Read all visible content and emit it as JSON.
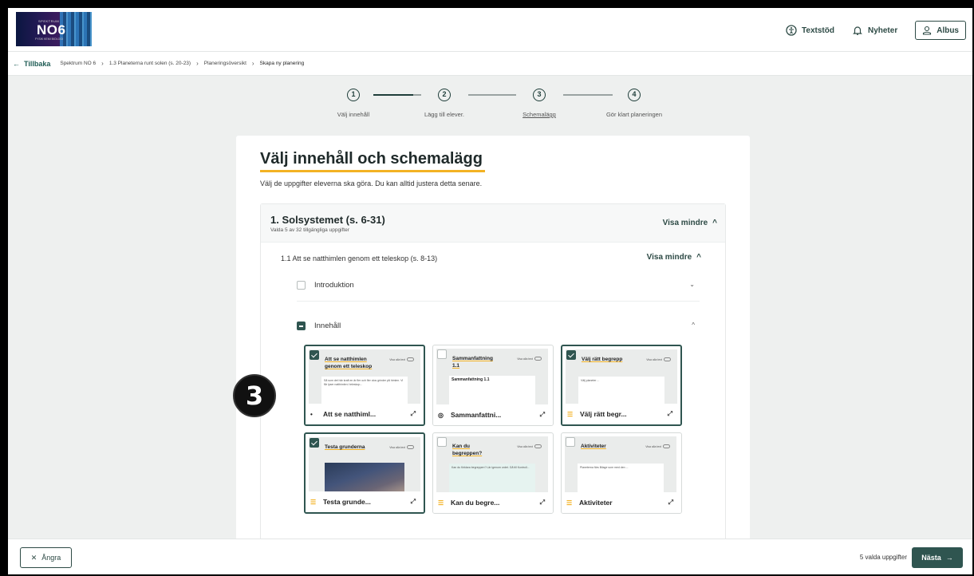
{
  "header": {
    "logo": {
      "top_text": "SPEKTRUM",
      "main": "NO6",
      "bottom_text": "FYSIK KEMI BIOLOGI"
    },
    "textstod": "Textstöd",
    "nyheter": "Nyheter",
    "user": "Albus"
  },
  "breadcrumb": {
    "back": "Tillbaka",
    "items": [
      "Spektrum NO 6",
      "1.3 Planeterna runt solen (s. 20-23)",
      "Planeringsöversikt",
      "Skapa ny planering"
    ]
  },
  "stepper": {
    "steps": [
      {
        "num": "1",
        "label": "Välj innehåll"
      },
      {
        "num": "2",
        "label": "Lägg till elever."
      },
      {
        "num": "3",
        "label": "Schemalägg"
      },
      {
        "num": "4",
        "label": "Gör klart planeringen"
      }
    ]
  },
  "main": {
    "title": "Välj innehåll och schemalägg",
    "subtitle": "Välj de uppgifter eleverna ska göra. Du kan alltid justera detta senare.",
    "section": {
      "title": "1. Solsystemet (s. 6-31)",
      "subtitle": "Valda 5 av 32 tillgängliga uppgifter",
      "toggle": "Visa mindre"
    },
    "subsection": {
      "title": "1.1 Att se natthimlen genom ett teleskop (s. 8-13)",
      "toggle": "Visa mindre"
    },
    "groups": [
      {
        "label": "Introduktion"
      },
      {
        "label": "Innehåll"
      }
    ],
    "tiles": [
      {
        "thumb_title": "Att se natthimlen genom ett teleskop",
        "label": "Att se natthiml...",
        "selected": true,
        "paper": "Så som det här kraft en är fler och fler olos grinder på himlen. Vi får lyser natthimlen i teleskop...",
        "toggle": "Visa alla text"
      },
      {
        "thumb_title": "Sammanfattning 1.1",
        "label": "Sammanfattni...",
        "selected": false,
        "paper": "Sammanfattning 1.1",
        "toggle": "Visa alla text"
      },
      {
        "thumb_title": "Välj rätt begrepp",
        "label": "Välj rätt begr...",
        "selected": true,
        "paper": "Välj planeter ...",
        "toggle": "Visa alla text"
      },
      {
        "thumb_title": "Testa grunderna",
        "label": "Testa grunde...",
        "selected": true,
        "paper": "",
        "toggle": "Visa alla text"
      },
      {
        "thumb_title": "Kan du begreppen?",
        "label": "Kan du begre...",
        "selected": false,
        "paper": "Kan du förklara begreppen? Lär igenom ordet. Gå till Kontroll...",
        "toggle": "Visa alla text"
      },
      {
        "thumb_title": "Aktiviteter",
        "label": "Aktiviteter",
        "selected": false,
        "paper": "Planeterna färs Bilage som med den ...",
        "toggle": "Visa alla text"
      }
    ]
  },
  "overlay_badge": "3",
  "footer": {
    "undo": "Ångra",
    "count": "5 valda uppgifter",
    "next": "Nästa"
  }
}
